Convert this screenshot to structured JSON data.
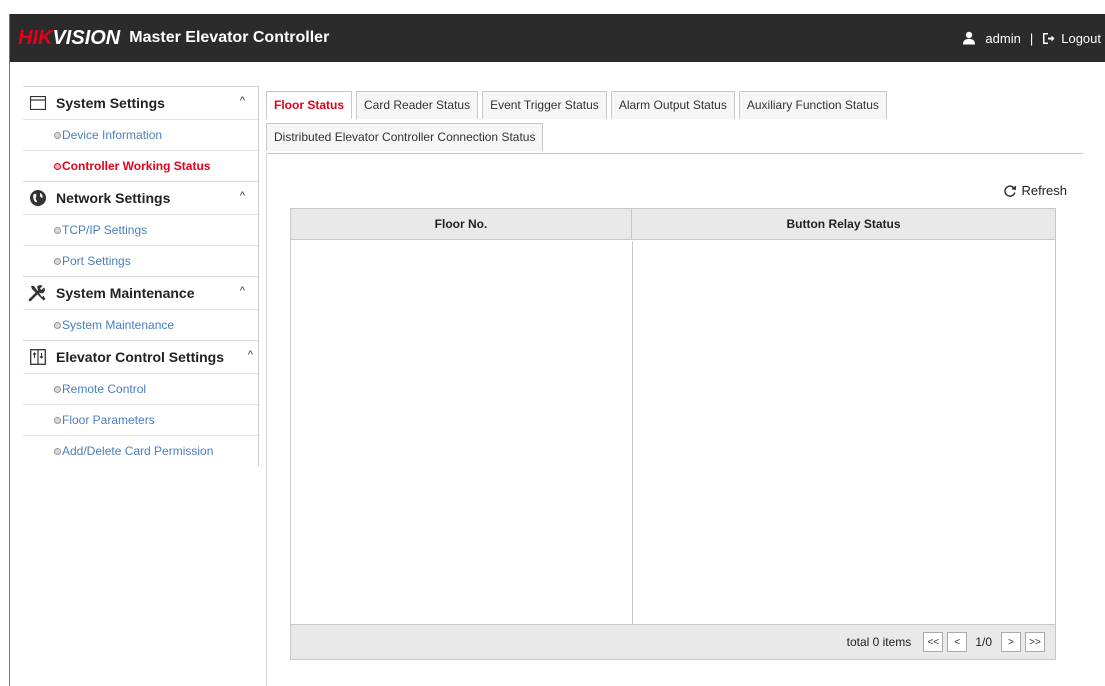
{
  "header": {
    "logo_red": "HIK",
    "logo_white": "VISION",
    "title": "Master Elevator Controller",
    "user": "admin",
    "separator": "|",
    "logout": "Logout"
  },
  "sidebar": {
    "groups": [
      {
        "title": "System Settings",
        "icon": "window-icon",
        "caret": "^",
        "items": [
          {
            "label": "Device Information"
          },
          {
            "label": "Controller Working Status",
            "active": true
          }
        ]
      },
      {
        "title": "Network Settings",
        "icon": "globe-icon",
        "caret": "^",
        "items": [
          {
            "label": "TCP/IP Settings"
          },
          {
            "label": "Port Settings"
          }
        ]
      },
      {
        "title": "System Maintenance",
        "icon": "tools-icon",
        "caret": "^",
        "items": [
          {
            "label": "System Maintenance"
          }
        ]
      },
      {
        "title": "Elevator Control Settings",
        "icon": "elevator-icon",
        "caret": "^",
        "items": [
          {
            "label": "Remote Control"
          },
          {
            "label": "Floor Parameters"
          },
          {
            "label": "Add/Delete Card Permission"
          }
        ]
      }
    ]
  },
  "tabs": {
    "row1": [
      "Floor Status",
      "Card Reader Status",
      "Event Trigger Status",
      "Alarm Output Status",
      "Auxiliary Function Status"
    ],
    "row2": [
      "Distributed Elevator Controller Connection Status"
    ],
    "active": "Floor Status"
  },
  "main": {
    "refresh": "Refresh",
    "columns": [
      "Floor No.",
      "Button Relay Status"
    ],
    "rows": [],
    "pagination": {
      "total": "total 0 items",
      "first": "<<",
      "prev": "<",
      "page": "1/0",
      "next": ">",
      "last": ">>"
    }
  },
  "colors": {
    "brand_red": "#e4001b",
    "header_bg": "#2b2b2b",
    "link_blue": "#4a7fc0"
  }
}
